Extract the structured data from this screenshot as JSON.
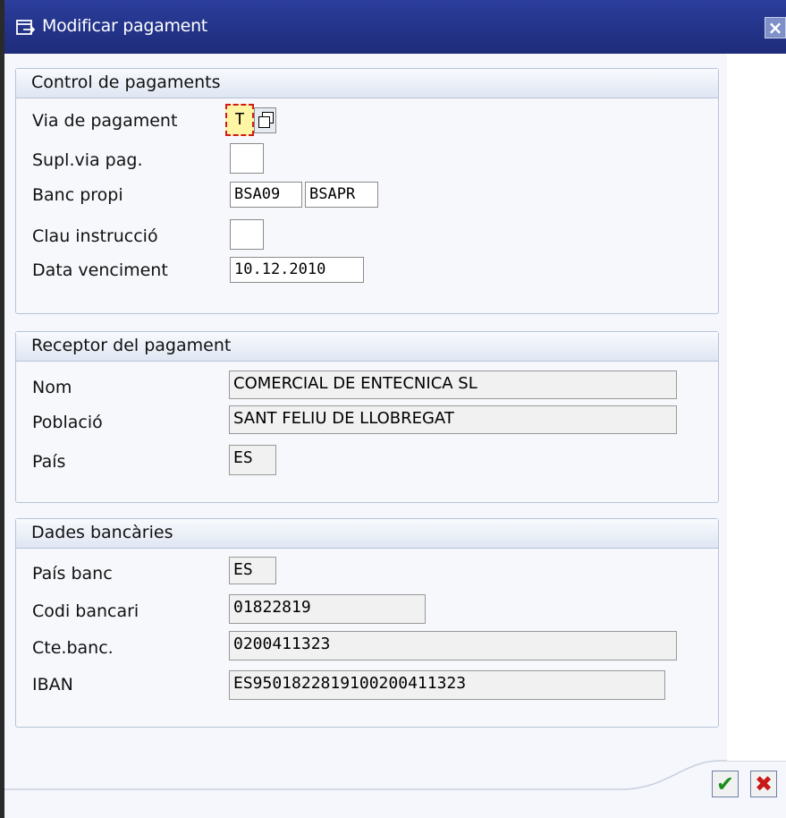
{
  "window": {
    "title": "Modificar pagament"
  },
  "control": {
    "title": "Control de pagaments",
    "via_label": "Via de pagament",
    "via_value": "T",
    "supl_label": "Supl.via pag.",
    "supl_value": "",
    "banc_label": "Banc propi",
    "banc_value1": "BSA09",
    "banc_value2": "BSAPR",
    "clau_label": "Clau instrucció",
    "clau_value": "",
    "data_label": "Data venciment",
    "data_value": "10.12.2010"
  },
  "receptor": {
    "title": "Receptor del pagament",
    "nom_label": "Nom",
    "nom_value": "COMERCIAL DE ENTECNICA SL",
    "poblacio_label": "Població",
    "poblacio_value": "SANT FELIU DE LLOBREGAT",
    "pais_label": "País",
    "pais_value": "ES"
  },
  "bancaries": {
    "title": "Dades bancàries",
    "pais_label": "País banc",
    "pais_value": "ES",
    "codi_label": "Codi bancari",
    "codi_value": "01822819",
    "cte_label": "Cte.banc.",
    "cte_value": "0200411323",
    "iban_label": "IBAN",
    "iban_value": "ES9501822819100200411323"
  },
  "icons": {
    "title": "edit-window-icon",
    "close": "close-icon",
    "ok": "checkmark-icon",
    "cancel": "cancel-x-icon",
    "f4": "possible-values-icon"
  }
}
